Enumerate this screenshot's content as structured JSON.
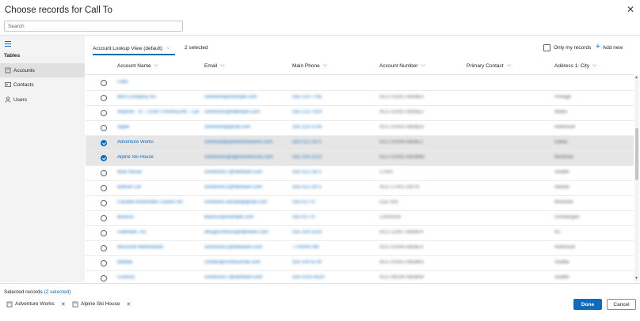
{
  "dialog": {
    "title": "Choose records for Call To",
    "close_icon": "close-icon"
  },
  "search": {
    "placeholder": "Search"
  },
  "sidebar": {
    "section_label": "Tables",
    "items": [
      {
        "label": "Accounts",
        "icon": "building-icon",
        "active": true
      },
      {
        "label": "Contacts",
        "icon": "contact-card-icon",
        "active": false
      },
      {
        "label": "Users",
        "icon": "person-icon",
        "active": false
      }
    ]
  },
  "toolbar": {
    "view_name": "Account Lookup View (default)",
    "selected_count": "2 selected",
    "only_my_records": "Only my records",
    "add_new": "Add new"
  },
  "grid": {
    "columns": [
      "Account Name",
      "Email",
      "Main Phone",
      "Account Number",
      "Primary Contact",
      "Address 1: City"
    ],
    "rows": [
      {
        "checked": false,
        "name": "Fabo",
        "email": "",
        "phone": "",
        "number": "",
        "contact": "",
        "city": ""
      },
      {
        "checked": false,
        "name": "Best Company Inc",
        "email": "someone@example.com",
        "phone": "555-123-7765",
        "number": "ACC-01001-A9D8E4",
        "contact": "",
        "city": "Portage"
      },
      {
        "checked": false,
        "name": "Abarnet - Vl - LOSK FHANGERN - Cars...",
        "email": "someone3@fabrikam.com",
        "phone": "555-123-7914",
        "number": "ACC-01002-A9D8E2",
        "contact": "",
        "city": "Miami"
      },
      {
        "checked": false,
        "name": "Apple",
        "email": "someone@gmail.com",
        "phone": "555-123-3793",
        "number": "ACC-01003-A9D8E8",
        "contact": "",
        "city": "Redmond"
      },
      {
        "checked": true,
        "name": "Adventure Works",
        "email": "someone@adventureworks.com",
        "phone": "555-012-2871",
        "number": "ACC-01004-A9D8L2",
        "contact": "",
        "city": "Dallas"
      },
      {
        "checked": true,
        "name": "Alpine Ski House",
        "email": "someone5@alpineskihouse.com",
        "phone": "555-100-2223",
        "number": "ACC-01005-A9D8M9",
        "contact": "",
        "city": "Montreal"
      },
      {
        "checked": false,
        "name": "Blue House",
        "email": "someone17@fabrikam.com",
        "phone": "555-012-2871",
        "number": "17003",
        "contact": "",
        "city": "Seattle"
      },
      {
        "checked": false,
        "name": "Bobcat Cat",
        "email": "someone11@fabrikam.com",
        "phone": "555-012-2871",
        "number": "ACC-17001-19078",
        "contact": "",
        "city": "Atlanta"
      },
      {
        "checked": false,
        "name": "Canada Resemtiles Leaves Inc",
        "email": "someone.canada@gmail.com",
        "phone": "555-01770",
        "number": "CDL-001",
        "contact": "",
        "city": "Montreal"
      },
      {
        "checked": false,
        "name": "Bluesss",
        "email": "bluesss@example.com",
        "phone": "555-01770",
        "number": "12300019",
        "contact": "",
        "city": "Grimbergen"
      },
      {
        "checked": false,
        "name": "Fabrikam, Inc.",
        "email": "designcontoso@fabrikam.com",
        "phone": "555-100-3233",
        "number": "ACC-12307-A9D8F4",
        "contact": "",
        "city": "NJ"
      },
      {
        "checked": false,
        "name": "Microsoft Netherlands",
        "email": "someone12@fabrikam.com",
        "phone": "7700000789",
        "number": "ACC-01004-A9D8L4",
        "contact": "",
        "city": "Redmond"
      },
      {
        "checked": false,
        "name": "Bataba",
        "email": "contact@contosomax.com",
        "phone": "555-100-8730",
        "number": "ACC-01002-A9D8K4",
        "contact": "",
        "city": "Seattle"
      },
      {
        "checked": false,
        "name": "Contoso",
        "email": "someone17@fabrikam.com",
        "phone": "555-0100-4520",
        "number": "ACC-08106-A9D8N4",
        "contact": "",
        "city": "Seattle"
      }
    ]
  },
  "footer": {
    "selected_label": "Selected records",
    "selected_count": "(2 selected)",
    "chips": [
      {
        "label": "Adventure Works",
        "icon": "building-icon"
      },
      {
        "label": "Alpine Ski House",
        "icon": "building-icon"
      }
    ],
    "done": "Done",
    "cancel": "Cancel"
  },
  "colors": {
    "accent": "#0f6cbd",
    "selected_row": "#e6e6e6",
    "sidebar_bg": "#f3f3f3"
  }
}
